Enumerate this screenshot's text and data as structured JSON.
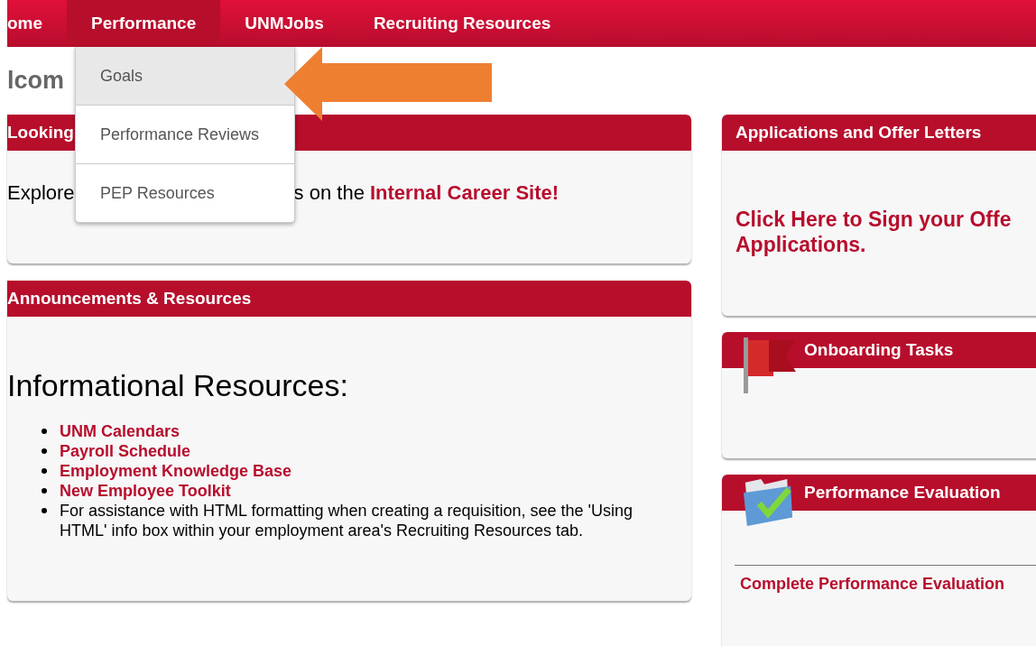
{
  "nav": {
    "tabs": [
      {
        "label": "ome",
        "selected": false
      },
      {
        "label": "Performance",
        "selected": true
      },
      {
        "label": "UNMJobs",
        "selected": false
      },
      {
        "label": "Recruiting Resources",
        "selected": false
      }
    ]
  },
  "dropdown": {
    "items": [
      {
        "label": "Goals",
        "selected": true
      },
      {
        "label": "Performance Reviews",
        "selected": false
      },
      {
        "label": "PEP Resources",
        "selected": false
      }
    ]
  },
  "welcome": "lcom",
  "career_panel": {
    "title": "Looking",
    "text_start": "Explore",
    "text_end": "s on the ",
    "link": "Internal Career Site!"
  },
  "announcements_panel": {
    "title": "Announcements & Resources",
    "heading": "Informational Resources:",
    "items": [
      {
        "kind": "link",
        "text": "UNM Calendars"
      },
      {
        "kind": "link",
        "text": "Payroll Schedule"
      },
      {
        "kind": "link",
        "text": "Employment Knowledge Base"
      },
      {
        "kind": "link",
        "text": "New Employee Toolkit"
      },
      {
        "kind": "text",
        "text": "For assistance with HTML formatting when creating a requisition, see the 'Using HTML' info box within your employment area's Recruiting Resources tab."
      }
    ]
  },
  "offers_panel": {
    "title": "Applications and Offer Letters",
    "link_lines": [
      "Click Here to Sign your Offe",
      "Applications."
    ]
  },
  "onboarding_panel": {
    "title": "Onboarding Tasks"
  },
  "evaluation_panel": {
    "title": "Performance Evaluation",
    "link": "Complete Performance Evaluation"
  }
}
